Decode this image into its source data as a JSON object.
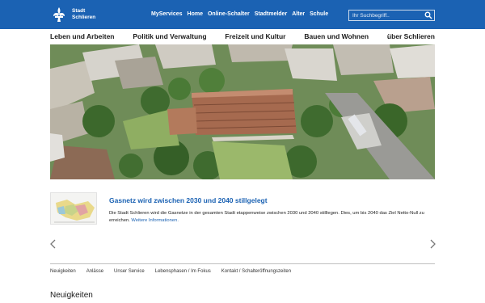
{
  "header": {
    "logo_line1": "Stadt",
    "logo_line2": "Schlieren",
    "nav_items": [
      "MyServices",
      "Home",
      "Online-Schalter",
      "Stadtmelder",
      "Alter",
      "Schule"
    ],
    "search_placeholder": "Ihr Suchbegriff..",
    "search_icon": "search-icon",
    "logo_icon": "fleur-de-lis-logo-icon",
    "color": "#1b62b3"
  },
  "main_nav": [
    "Leben und Arbeiten",
    "Politik und Verwaltung",
    "Freizeit und Kultur",
    "Bauen und Wohnen",
    "über Schlieren"
  ],
  "news": {
    "title": "Gasnetz wird zwischen 2030 und 2040 stillgelegt",
    "text": "Die Stadt Schlieren wird die Gasnetze in der gesamten Stadt etappenweise zwischen 2030 und 2040 stilllegen. Dies, um bis 2040 das Ziel Netto-Null zu erreichen.",
    "link": "Weitere Informationen."
  },
  "carousel": {
    "prev_icon": "chevron-left-icon",
    "next_icon": "chevron-right-icon"
  },
  "tabs": [
    "Neuigkeiten",
    "Anlässe",
    "Unser Service",
    "Lebensphasen / Im Fokus",
    "Kontakt / Schalteröffnungszeiten"
  ],
  "section_title": "Neuigkeiten"
}
